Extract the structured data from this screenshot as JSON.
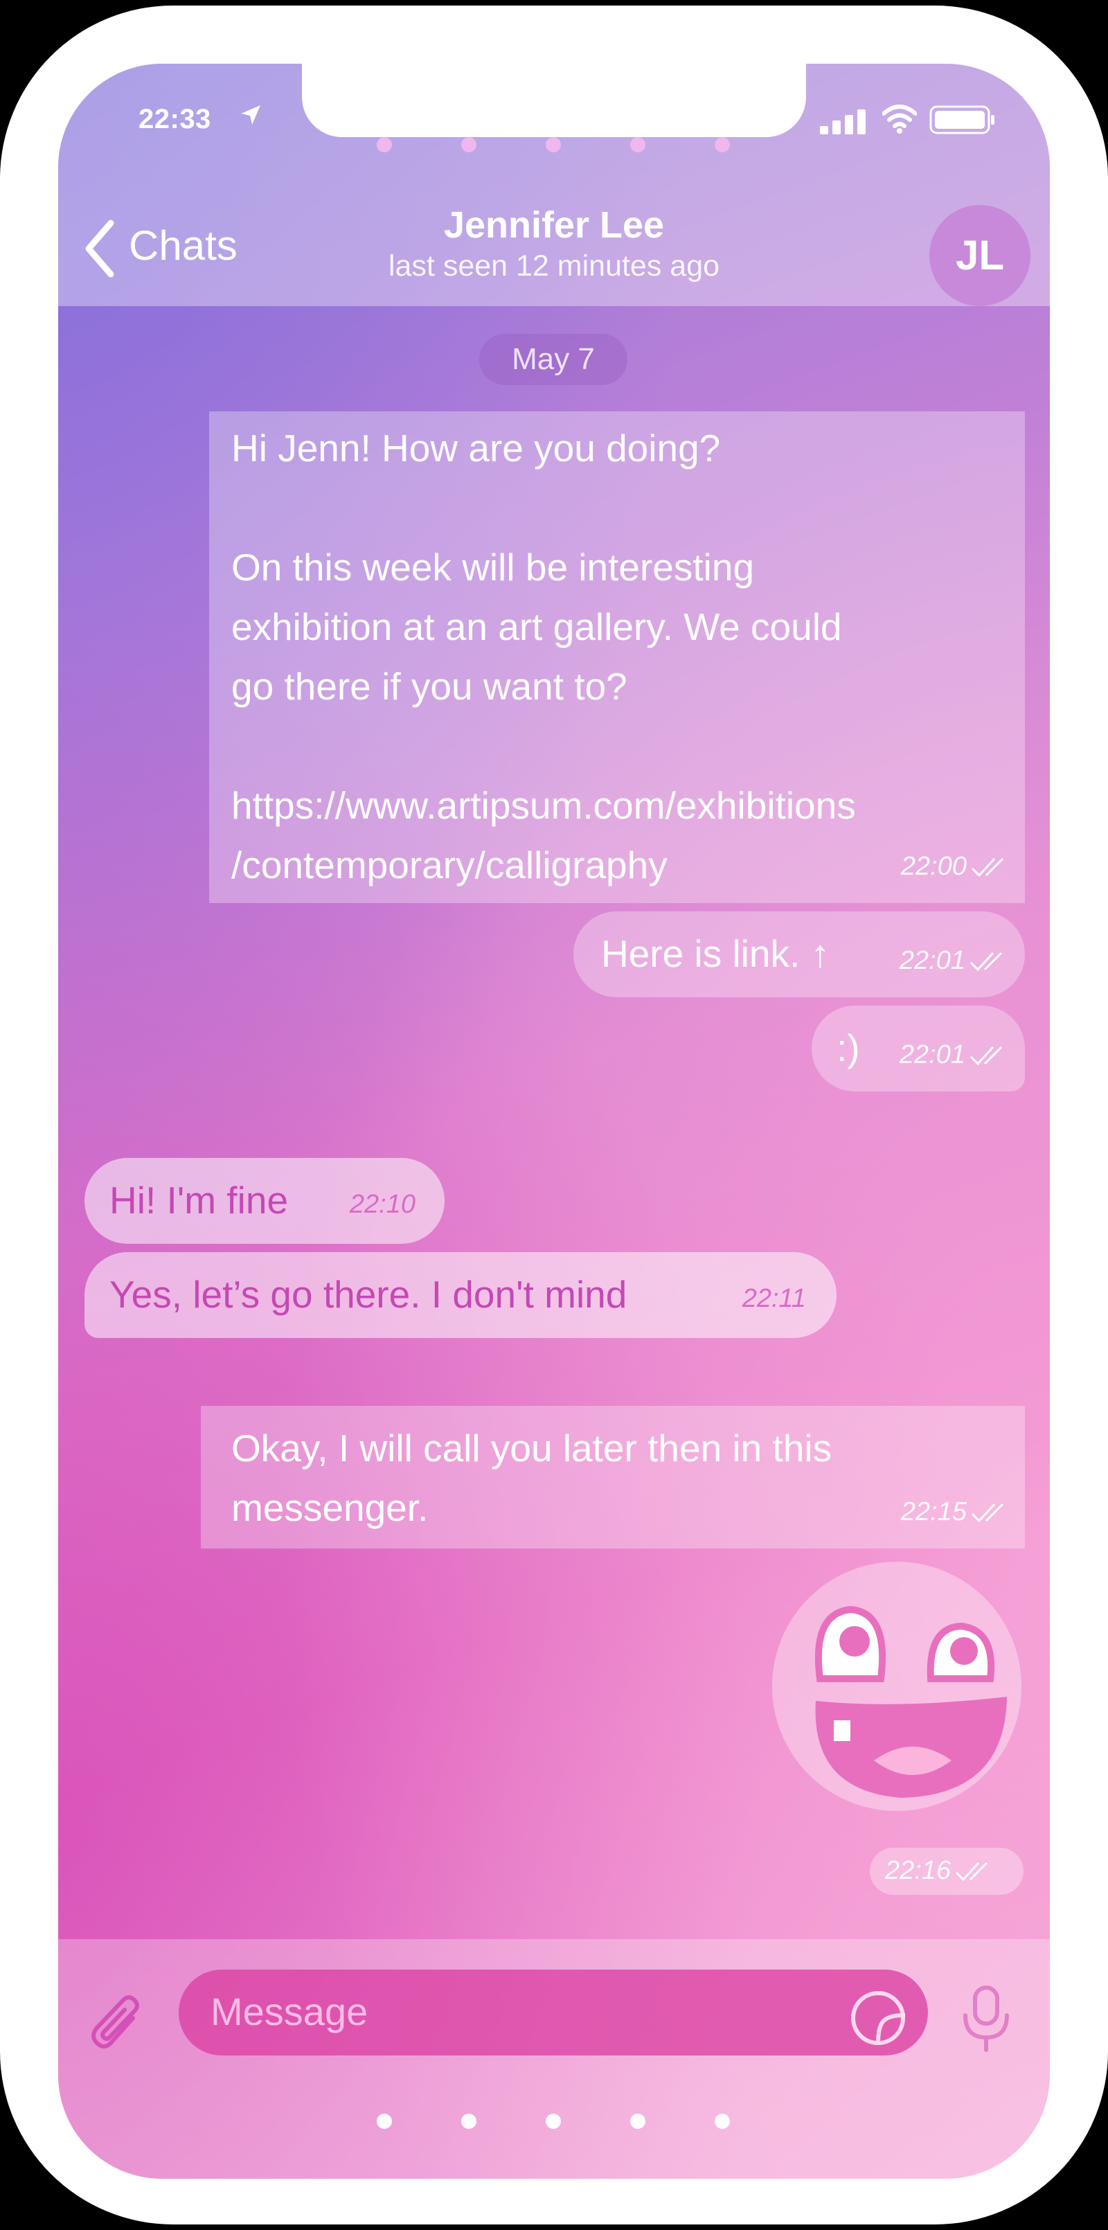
{
  "status_bar": {
    "time": "22:33"
  },
  "header": {
    "back_label": "Chats",
    "title": "Jennifer Lee",
    "subtitle": "last seen 12 minutes ago",
    "avatar_initials": "JL"
  },
  "date_divider": "May 7",
  "messages": [
    {
      "direction": "out",
      "text": "Hi Jenn! How are you doing?\n\nOn this week will be interesting\nexhibition at an art gallery. We could\ngo there if you want to?\n\nhttps://www.artipsum.com/exhibitions\n/contemporary/calligraphy",
      "time": "22:00"
    },
    {
      "direction": "out",
      "text": "Here is link. ↑",
      "time": "22:01"
    },
    {
      "direction": "out",
      "text": ":)",
      "time": "22:01"
    },
    {
      "direction": "in",
      "text": "Hi! I'm fine",
      "time": "22:10"
    },
    {
      "direction": "in",
      "text": "Yes, let’s go there. I don't mind",
      "time": "22:11"
    },
    {
      "direction": "out",
      "text": "Okay, I will call you later then in this\nmessenger.",
      "time": "22:15"
    },
    {
      "direction": "out",
      "text": "",
      "time": "22:16",
      "sticker": "awesome-face-sticker"
    }
  ],
  "composer": {
    "placeholder": "Message"
  },
  "icons": [
    "location-arrow-icon",
    "signal-icon",
    "wifi-icon",
    "battery-icon",
    "back-chevron-icon",
    "read-ticks-icon",
    "attach-icon",
    "sticker-icon",
    "microphone-icon"
  ],
  "colors": {
    "incoming_text": "#c548b3",
    "outgoing_text": "#ffffff"
  }
}
